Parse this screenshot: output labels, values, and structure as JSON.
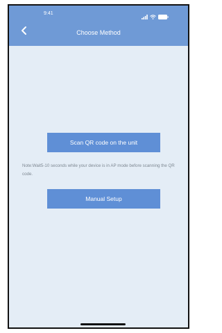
{
  "status_bar": {
    "time": "9:41",
    "signal_icon": "signal-icon",
    "wifi_icon": "wifi-icon",
    "battery_icon": "battery-icon"
  },
  "header": {
    "back_icon": "chevron-left-icon",
    "title": "Choose Method"
  },
  "main": {
    "scan_button_label": "Scan QR code on the unit",
    "note": "Note:Wait5-10 seconds while your device is in AP mode before scanning the QR code.",
    "manual_button_label": "Manual Setup"
  },
  "colors": {
    "header_bg": "#6f9ad6",
    "button_bg": "#5f8fd6",
    "page_bg": "#e4edf6"
  }
}
